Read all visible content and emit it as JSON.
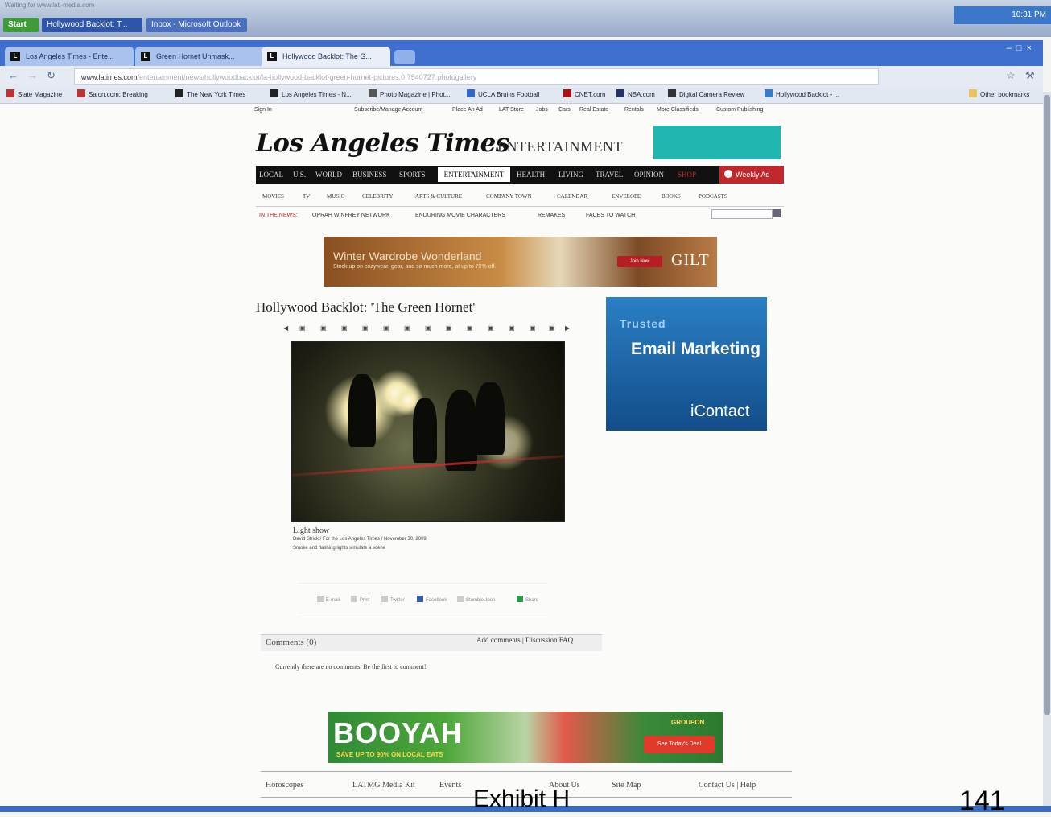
{
  "taskbar": {
    "faint_caption": "Waiting for www.lati-media.com",
    "start_label": "Start",
    "task1": "Hollywood Backlot: T...",
    "task2": "Inbox - Microsoft Outlook",
    "clock": "10:31 PM"
  },
  "browser": {
    "tabs": [
      {
        "label": "Los Angeles Times - Ente...",
        "icon": "lat-favicon"
      },
      {
        "label": "Green Hornet Unmask...",
        "icon": "lat-favicon"
      },
      {
        "label": "Hollywood Backlot: The G...",
        "icon": "lat-favicon"
      }
    ],
    "url_host": "www.latimes.com",
    "url_path": "/entertainment/news/hollywoodbacklot/la-hollywood-backlot-green-hornet-pictures,0,7540727.photogallery",
    "bookmarks": [
      "Slate Magazine",
      "Salon.com: Breaking",
      "The New York Times",
      "Los Angeles Times - N...",
      "Photo Magazine | Phot...",
      "UCLA Bruins Football",
      "CNET.com",
      "NBA.com",
      "Digital Camera Review",
      "Hollywood Backlot - ..."
    ],
    "other_bookmarks": "Other bookmarks"
  },
  "page": {
    "util_links": [
      "Sign In",
      "Subscribe/Manage Account",
      "Place An Ad",
      "LAT Store",
      "Jobs",
      "Cars",
      "Real Estate",
      "Rentals",
      "More Classifieds",
      "Custom Publishing"
    ],
    "logo": "Los Angeles Times",
    "section": "ENTERTAINMENT",
    "nav": [
      "LOCAL",
      "U.S.",
      "WORLD",
      "BUSINESS",
      "SPORTS",
      "ENTERTAINMENT",
      "HEALTH",
      "LIVING",
      "TRAVEL",
      "OPINION",
      "SHOP"
    ],
    "weekly_ad": "Weekly Ad",
    "subnav": [
      "MOVIES",
      "TV",
      "MUSIC",
      "CELEBRITY",
      "ARTS & CULTURE",
      "COMPANY TOWN",
      "CALENDAR",
      "ENVELOPE",
      "BOOKS",
      "PODCASTS"
    ],
    "in_the_news_label": "IN THE NEWS:",
    "in_the_news": [
      "OPRAH WINFREY NETWORK",
      "ENDURING MOVIE CHARACTERS",
      "REMAKES",
      "FACES TO WATCH"
    ],
    "gilt_ad": {
      "headline": "Winter Wardrobe Wonderland",
      "sub": "Stock up on cozywear, gear, and so much more, at up to 70% off.",
      "button": "Join Now",
      "brand": "GILT"
    },
    "article_title": "Hollywood Backlot: 'The Green Hornet'",
    "caption_head": "Light show",
    "caption_credit": "David Strick / For the Los Angeles Times / November 30, 2009",
    "caption_desc": "Smoke and flashing lights simulate a scene",
    "share": [
      "E-mail",
      "Print",
      "Twitter",
      "Facebook",
      "StumbleUpon",
      "Share"
    ],
    "icontact_ad": {
      "top": "Trusted",
      "headline": "Email Marketing",
      "brand": "iContact"
    },
    "comments_header": "Comments (0)",
    "comments_links": "Add comments | Discussion FAQ",
    "comments_none": "Currently there are no comments. Be the first to comment!",
    "booyah_ad": {
      "headline": "BOOYAH",
      "sub": "SAVE UP TO 90% ON LOCAL EATS",
      "brand": "GROUPON",
      "button": "See Today's Deal"
    },
    "footer": [
      "Horoscopes",
      "LATMG Media Kit",
      "Events",
      "About Us",
      "Site Map",
      "Contact Us | Help"
    ]
  },
  "exhibit_label": "Exhibit H",
  "page_number": "141"
}
